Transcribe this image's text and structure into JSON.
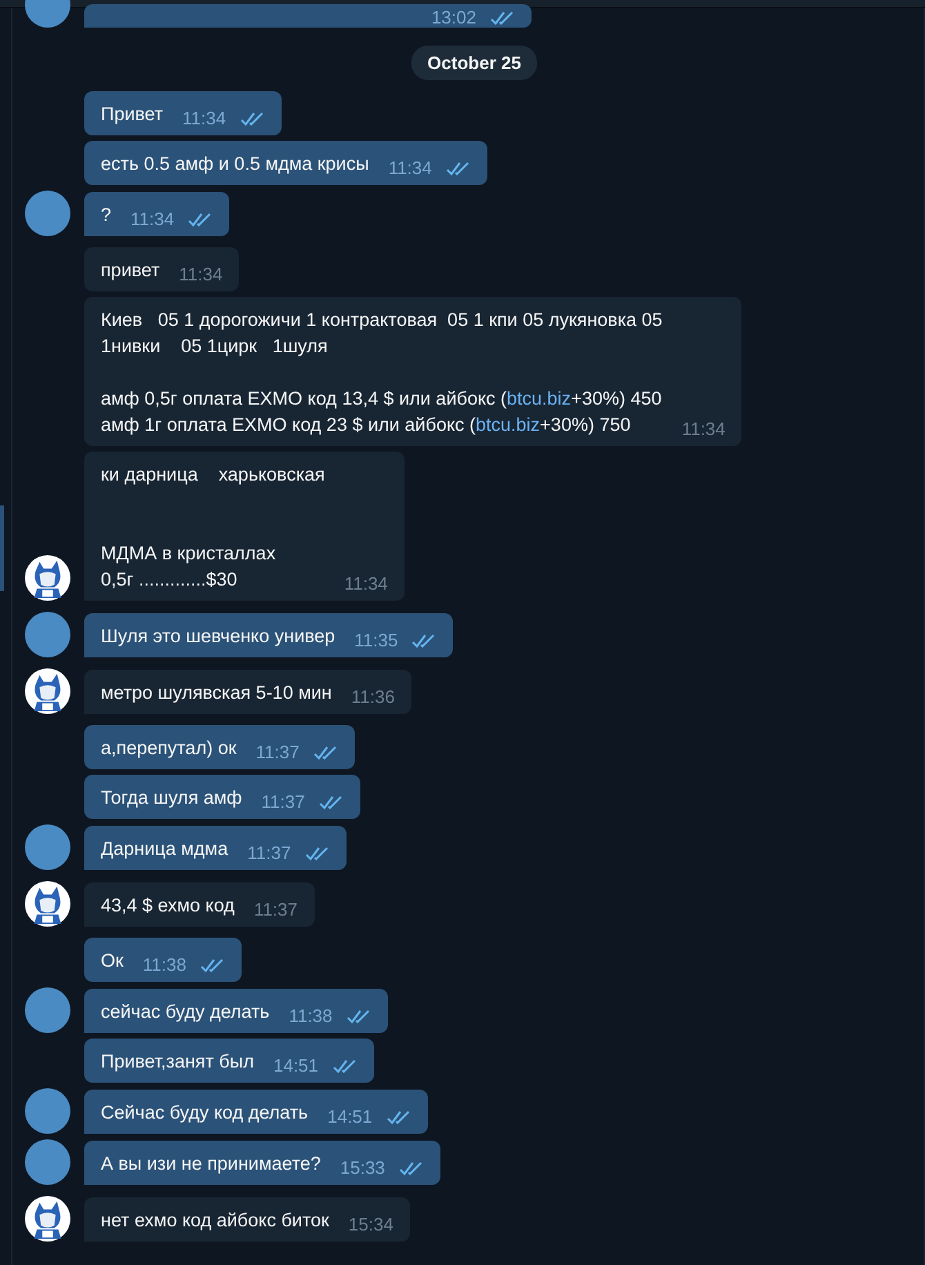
{
  "earlier_messages": [
    {
      "outgoing": true,
      "time": "13:02",
      "read": true,
      "avatar": {
        "kind": "plain"
      }
    }
  ],
  "date_separator": "October 25",
  "messages": [
    {
      "outgoing": true,
      "time": "11:34",
      "read": true,
      "lines": [
        {
          "kind": "text",
          "text": "Привет"
        }
      ]
    },
    {
      "outgoing": true,
      "time": "11:34",
      "read": true,
      "lines": [
        {
          "kind": "text",
          "text": "есть 0.5 амф и 0.5 мдма крисы"
        }
      ]
    },
    {
      "outgoing": true,
      "time": "11:34",
      "read": true,
      "avatar": {
        "kind": "plain"
      },
      "lines": [
        {
          "kind": "text",
          "text": "?"
        }
      ]
    },
    {
      "outgoing": false,
      "time": "11:34",
      "lines": [
        {
          "kind": "text",
          "text": "привет"
        }
      ]
    },
    {
      "outgoing": false,
      "time": "11:34",
      "lines": [
        {
          "kind": "text",
          "text": "Киев   05 1 дорогожичи 1 контрактовая  05 1 кпи 05 лукяновка 05"
        },
        {
          "kind": "text",
          "text": "1нивки    05 1цирк   1шуля"
        },
        {
          "kind": "gap"
        },
        {
          "kind": "rich",
          "parts": [
            {
              "text": "амф 0,5г оплата EXMO код 13,4 $ или айбокс (",
              "link": false
            },
            {
              "text": "btcu.biz",
              "link": true
            },
            {
              "text": "+30%) 450",
              "link": false
            }
          ]
        },
        {
          "kind": "rich",
          "parts": [
            {
              "text": "амф 1г оплата EXMO код 23 $ или айбокс (",
              "link": false
            },
            {
              "text": "btcu.biz",
              "link": true
            },
            {
              "text": "+30%) 750",
              "link": false
            }
          ]
        }
      ]
    },
    {
      "outgoing": false,
      "time": "11:34",
      "avatar": {
        "kind": "cartoon"
      },
      "lines": [
        {
          "kind": "text",
          "text": "ки дарница    харьковская"
        },
        {
          "kind": "gap"
        },
        {
          "kind": "gap"
        },
        {
          "kind": "text",
          "text": "МДМА в кристаллах"
        },
        {
          "kind": "text",
          "text": "0,5г .............$30"
        }
      ]
    },
    {
      "outgoing": true,
      "time": "11:35",
      "read": true,
      "avatar": {
        "kind": "plain"
      },
      "lines": [
        {
          "kind": "text",
          "text": "Шуля это шевченко универ"
        }
      ]
    },
    {
      "outgoing": false,
      "time": "11:36",
      "avatar": {
        "kind": "cartoon"
      },
      "lines": [
        {
          "kind": "text",
          "text": "метро шулявская 5-10 мин"
        }
      ]
    },
    {
      "outgoing": true,
      "time": "11:37",
      "read": true,
      "lines": [
        {
          "kind": "text",
          "text": "а,перепутал) ок"
        }
      ]
    },
    {
      "outgoing": true,
      "time": "11:37",
      "read": true,
      "lines": [
        {
          "kind": "text",
          "text": "Тогда шуля амф"
        }
      ]
    },
    {
      "outgoing": true,
      "time": "11:37",
      "read": true,
      "avatar": {
        "kind": "plain"
      },
      "lines": [
        {
          "kind": "text",
          "text": "Дарница мдма"
        }
      ]
    },
    {
      "outgoing": false,
      "time": "11:37",
      "avatar": {
        "kind": "cartoon"
      },
      "lines": [
        {
          "kind": "text",
          "text": "43,4 $ ехмо код"
        }
      ]
    },
    {
      "outgoing": true,
      "time": "11:38",
      "read": true,
      "lines": [
        {
          "kind": "text",
          "text": "Ок"
        }
      ]
    },
    {
      "outgoing": true,
      "time": "11:38",
      "read": true,
      "avatar": {
        "kind": "plain"
      },
      "lines": [
        {
          "kind": "text",
          "text": "сейчас буду делать"
        }
      ]
    },
    {
      "outgoing": true,
      "time": "14:51",
      "read": true,
      "lines": [
        {
          "kind": "text",
          "text": "Привет,занят был"
        }
      ]
    },
    {
      "outgoing": true,
      "time": "14:51",
      "read": true,
      "avatar": {
        "kind": "plain"
      },
      "lines": [
        {
          "kind": "text",
          "text": "Сейчас буду код делать"
        }
      ]
    },
    {
      "outgoing": true,
      "time": "15:33",
      "read": true,
      "avatar": {
        "kind": "plain"
      },
      "lines": [
        {
          "kind": "text",
          "text": "А вы изи не принимаете?"
        }
      ]
    },
    {
      "outgoing": false,
      "time": "15:34",
      "avatar": {
        "kind": "cartoon"
      },
      "lines": [
        {
          "kind": "text",
          "text": "нет ехмо код айбокс биток"
        }
      ]
    }
  ]
}
